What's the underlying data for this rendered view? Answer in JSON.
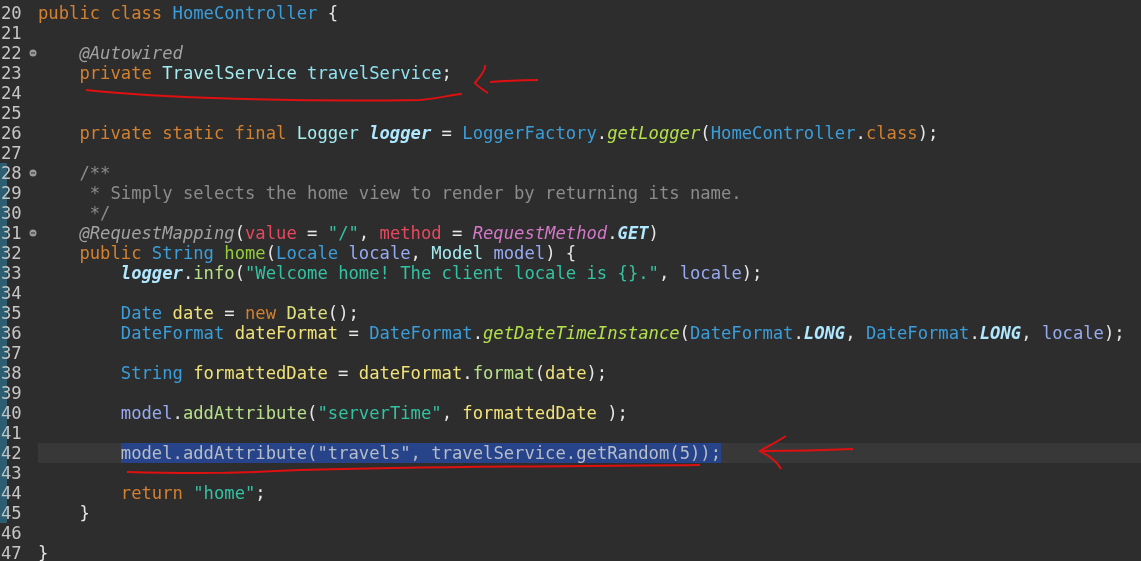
{
  "editor": {
    "lines": [
      {
        "number": "20",
        "fold": false,
        "changed": false,
        "selected": false,
        "tokens": [
          {
            "t": "public class ",
            "kind": "kw"
          },
          {
            "t": "HomeController",
            "kind": "cls"
          },
          {
            "t": " {",
            "kind": "plain"
          }
        ]
      },
      {
        "number": "21",
        "fold": false,
        "changed": false,
        "selected": false
      },
      {
        "number": "22",
        "fold": true,
        "changed": false,
        "selected": false,
        "tokens": [
          {
            "t": "    @Autowired",
            "kind": "ann"
          }
        ]
      },
      {
        "number": "23",
        "fold": false,
        "changed": false,
        "selected": false,
        "tokens": [
          {
            "t": "    private ",
            "kind": "kw"
          },
          {
            "t": "TravelService ",
            "kind": "iface"
          },
          {
            "t": "travelService",
            "kind": "field"
          },
          {
            "t": ";",
            "kind": "plain"
          }
        ]
      },
      {
        "number": "24",
        "fold": false,
        "changed": false,
        "selected": false
      },
      {
        "number": "25",
        "fold": false,
        "changed": false,
        "selected": false
      },
      {
        "number": "26",
        "fold": false,
        "changed": false,
        "selected": false,
        "tokens": [
          {
            "t": "    private static final ",
            "kind": "kw"
          },
          {
            "t": "Logger ",
            "kind": "iface"
          },
          {
            "t": "logger",
            "kind": "sfield"
          },
          {
            "t": " = ",
            "kind": "plain"
          },
          {
            "t": "LoggerFactory",
            "kind": "cls"
          },
          {
            "t": ".",
            "kind": "plain"
          },
          {
            "t": "getLogger",
            "kind": "smethod"
          },
          {
            "t": "(",
            "kind": "plain"
          },
          {
            "t": "HomeController",
            "kind": "cls"
          },
          {
            "t": ".",
            "kind": "plain"
          },
          {
            "t": "class",
            "kind": "kw"
          },
          {
            "t": ");",
            "kind": "plain"
          }
        ]
      },
      {
        "number": "27",
        "fold": false,
        "changed": false,
        "selected": false
      },
      {
        "number": "28",
        "fold": true,
        "changed": true,
        "selected": false,
        "tokens": [
          {
            "t": "    /**",
            "kind": "cmt"
          }
        ]
      },
      {
        "number": "29",
        "fold": false,
        "changed": true,
        "selected": false,
        "tokens": [
          {
            "t": "     * Simply selects the home view to render by returning its name.",
            "kind": "cmt"
          }
        ]
      },
      {
        "number": "30",
        "fold": false,
        "changed": true,
        "selected": false,
        "tokens": [
          {
            "t": "     */",
            "kind": "cmt"
          }
        ]
      },
      {
        "number": "31",
        "fold": true,
        "changed": true,
        "selected": false,
        "tokens": [
          {
            "t": "    @RequestMapping",
            "kind": "ann"
          },
          {
            "t": "(",
            "kind": "plain"
          },
          {
            "t": "value",
            "kind": "attr"
          },
          {
            "t": " = ",
            "kind": "plain"
          },
          {
            "t": "\"/\"",
            "kind": "str"
          },
          {
            "t": ", ",
            "kind": "plain"
          },
          {
            "t": "method",
            "kind": "attr"
          },
          {
            "t": " = ",
            "kind": "plain"
          },
          {
            "t": "RequestMethod",
            "kind": "enum"
          },
          {
            "t": ".",
            "kind": "plain"
          },
          {
            "t": "GET",
            "kind": "sfield"
          },
          {
            "t": ")",
            "kind": "plain"
          }
        ]
      },
      {
        "number": "32",
        "fold": false,
        "changed": true,
        "selected": false,
        "tokens": [
          {
            "t": "    public ",
            "kind": "kw"
          },
          {
            "t": "String ",
            "kind": "cls"
          },
          {
            "t": "home",
            "kind": "decl"
          },
          {
            "t": "(",
            "kind": "plain"
          },
          {
            "t": "Locale ",
            "kind": "cls"
          },
          {
            "t": "locale",
            "kind": "param"
          },
          {
            "t": ", ",
            "kind": "plain"
          },
          {
            "t": "Model ",
            "kind": "iface"
          },
          {
            "t": "model",
            "kind": "param"
          },
          {
            "t": ") {",
            "kind": "plain"
          }
        ]
      },
      {
        "number": "33",
        "fold": false,
        "changed": true,
        "selected": false,
        "tokens": [
          {
            "t": "        logger",
            "kind": "sfield"
          },
          {
            "t": ".",
            "kind": "plain"
          },
          {
            "t": "info",
            "kind": "method"
          },
          {
            "t": "(",
            "kind": "plain"
          },
          {
            "t": "\"Welcome home! The client locale is {}.\"",
            "kind": "str"
          },
          {
            "t": ", ",
            "kind": "plain"
          },
          {
            "t": "locale",
            "kind": "param"
          },
          {
            "t": ");",
            "kind": "plain"
          }
        ]
      },
      {
        "number": "34",
        "fold": false,
        "changed": true,
        "selected": false
      },
      {
        "number": "35",
        "fold": false,
        "changed": true,
        "selected": false,
        "tokens": [
          {
            "t": "        Date ",
            "kind": "cls"
          },
          {
            "t": "date",
            "kind": "local"
          },
          {
            "t": " = ",
            "kind": "plain"
          },
          {
            "t": "new ",
            "kind": "kw"
          },
          {
            "t": "Date",
            "kind": "ctor"
          },
          {
            "t": "();",
            "kind": "plain"
          }
        ]
      },
      {
        "number": "36",
        "fold": false,
        "changed": true,
        "selected": false,
        "tokens": [
          {
            "t": "        DateFormat ",
            "kind": "cls"
          },
          {
            "t": "dateFormat",
            "kind": "local"
          },
          {
            "t": " = ",
            "kind": "plain"
          },
          {
            "t": "DateFormat",
            "kind": "cls"
          },
          {
            "t": ".",
            "kind": "plain"
          },
          {
            "t": "getDateTimeInstance",
            "kind": "smethod"
          },
          {
            "t": "(",
            "kind": "plain"
          },
          {
            "t": "DateFormat",
            "kind": "cls"
          },
          {
            "t": ".",
            "kind": "plain"
          },
          {
            "t": "LONG",
            "kind": "sfield"
          },
          {
            "t": ", ",
            "kind": "plain"
          },
          {
            "t": "DateFormat",
            "kind": "cls"
          },
          {
            "t": ".",
            "kind": "plain"
          },
          {
            "t": "LONG",
            "kind": "sfield"
          },
          {
            "t": ", ",
            "kind": "plain"
          },
          {
            "t": "locale",
            "kind": "param"
          },
          {
            "t": ");",
            "kind": "plain"
          }
        ]
      },
      {
        "number": "37",
        "fold": false,
        "changed": true,
        "selected": false
      },
      {
        "number": "38",
        "fold": false,
        "changed": true,
        "selected": false,
        "tokens": [
          {
            "t": "        String ",
            "kind": "cls"
          },
          {
            "t": "formattedDate",
            "kind": "local"
          },
          {
            "t": " = ",
            "kind": "plain"
          },
          {
            "t": "dateFormat",
            "kind": "local"
          },
          {
            "t": ".",
            "kind": "plain"
          },
          {
            "t": "format",
            "kind": "method"
          },
          {
            "t": "(",
            "kind": "plain"
          },
          {
            "t": "date",
            "kind": "local"
          },
          {
            "t": ");",
            "kind": "plain"
          }
        ]
      },
      {
        "number": "39",
        "fold": false,
        "changed": true,
        "selected": false
      },
      {
        "number": "40",
        "fold": false,
        "changed": true,
        "selected": false,
        "tokens": [
          {
            "t": "        model",
            "kind": "param"
          },
          {
            "t": ".",
            "kind": "plain"
          },
          {
            "t": "addAttribute",
            "kind": "method"
          },
          {
            "t": "(",
            "kind": "plain"
          },
          {
            "t": "\"serverTime\"",
            "kind": "str"
          },
          {
            "t": ", ",
            "kind": "plain"
          },
          {
            "t": "formattedDate",
            "kind": "local"
          },
          {
            "t": " );",
            "kind": "plain"
          }
        ]
      },
      {
        "number": "41",
        "fold": false,
        "changed": true,
        "selected": false
      },
      {
        "number": "42",
        "fold": false,
        "changed": true,
        "selected": true,
        "tokens": [
          {
            "t": "        model",
            "kind": "param"
          },
          {
            "t": ".",
            "kind": "plain"
          },
          {
            "t": "addAttribute",
            "kind": "method"
          },
          {
            "t": "(",
            "kind": "plain"
          },
          {
            "t": "\"travels\"",
            "kind": "str"
          },
          {
            "t": ", ",
            "kind": "plain"
          },
          {
            "t": "travelService",
            "kind": "field"
          },
          {
            "t": ".",
            "kind": "plain"
          },
          {
            "t": "getRandom",
            "kind": "method"
          },
          {
            "t": "(5));",
            "kind": "plain"
          }
        ]
      },
      {
        "number": "43",
        "fold": false,
        "changed": true,
        "selected": false
      },
      {
        "number": "44",
        "fold": false,
        "changed": true,
        "selected": false,
        "tokens": [
          {
            "t": "        return ",
            "kind": "kw"
          },
          {
            "t": "\"home\"",
            "kind": "str"
          },
          {
            "t": ";",
            "kind": "plain"
          }
        ]
      },
      {
        "number": "45",
        "fold": false,
        "changed": true,
        "selected": false,
        "tokens": [
          {
            "t": "    }",
            "kind": "plain"
          }
        ]
      },
      {
        "number": "46",
        "fold": false,
        "changed": false,
        "selected": false
      },
      {
        "number": "47",
        "fold": false,
        "changed": false,
        "selected": false,
        "tokens": [
          {
            "t": "}",
            "kind": "plain"
          }
        ]
      }
    ]
  }
}
